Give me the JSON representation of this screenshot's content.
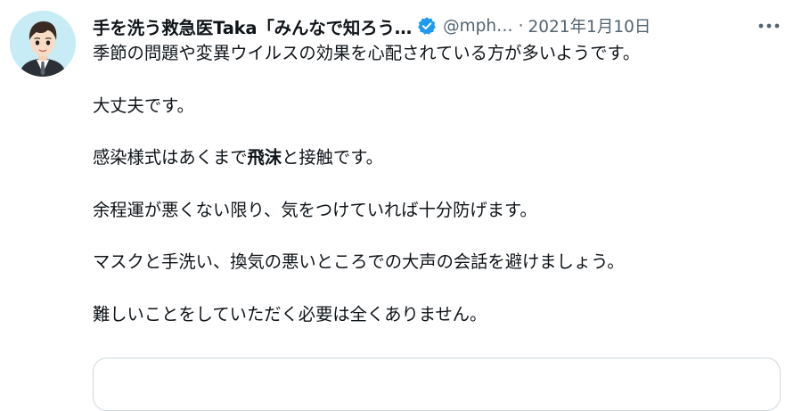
{
  "tweet": {
    "author": {
      "display_name": "手を洗う救急医Taka「みんなで知ろう…",
      "handle": "@mph…",
      "verified_icon": "verified-badge-icon",
      "avatar_icon": "cartoon-doctor-avatar"
    },
    "separator": "·",
    "date": "2021年1月10日",
    "more_icon": "more-dots-icon",
    "body": {
      "p1": "季節の問題や変異ウイルスの効果を心配されている方が多いようです。",
      "p2": "大丈夫です。",
      "p3_before": "感染様式はあくまで",
      "p3_bold": "飛沫",
      "p3_after": "と接触です。",
      "p4": "余程運が悪くない限り、気をつけていれば十分防げます。",
      "p5": "マスクと手洗い、換気の悪いところでの大声の会話を避けましょう。",
      "p6": "難しいことをしていただく必要は全くありません。"
    },
    "colors": {
      "text": "#0f1419",
      "secondary": "#536471",
      "verified": "#1d9bf0",
      "card_border": "#cfd9de"
    }
  }
}
